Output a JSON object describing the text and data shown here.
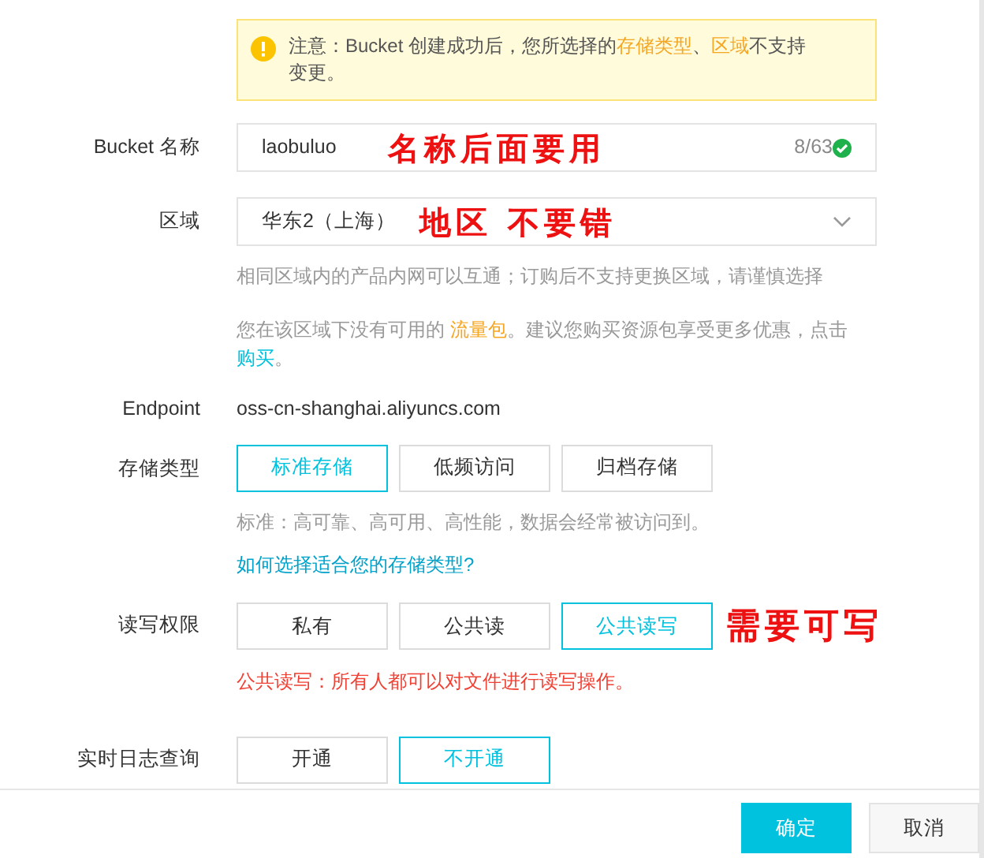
{
  "notice": {
    "segments": [
      {
        "text": "注意：Bucket 创建成功后，您所选择的",
        "kind": "plain"
      },
      {
        "text": "存储类型",
        "kind": "highlight"
      },
      {
        "text": "、",
        "kind": "plain"
      },
      {
        "text": "区域",
        "kind": "highlight"
      },
      {
        "text": "不支持变更。",
        "kind": "plain"
      }
    ]
  },
  "name_field": {
    "label": "Bucket 名称",
    "value": "laobuluo",
    "counter": "8/63",
    "valid": true,
    "annotation": "名称后面要用"
  },
  "region_field": {
    "label": "区域",
    "value": "华东2（上海）",
    "annotation": "地区 不要错",
    "hint": "相同区域内的产品内网可以互通；订购后不支持更换区域，请谨慎选择",
    "promo": [
      {
        "text": "您在该区域下没有可用的 ",
        "kind": "plain"
      },
      {
        "text": "流量包",
        "kind": "highlight"
      },
      {
        "text": "。建议您购买资源包享受更多优惠，点击 ",
        "kind": "plain"
      },
      {
        "text": "购买",
        "kind": "link"
      },
      {
        "text": "。",
        "kind": "plain"
      }
    ]
  },
  "endpoint": {
    "label": "Endpoint",
    "value": "oss-cn-shanghai.aliyuncs.com"
  },
  "storage_class": {
    "label": "存储类型",
    "options": [
      {
        "label": "标准存储",
        "selected": true
      },
      {
        "label": "低频访问",
        "selected": false
      },
      {
        "label": "归档存储",
        "selected": false
      }
    ],
    "hint": "标准：高可靠、高可用、高性能，数据会经常被访问到。",
    "link": "如何选择适合您的存储类型?"
  },
  "acl": {
    "label": "读写权限",
    "options": [
      {
        "label": "私有",
        "selected": false
      },
      {
        "label": "公共读",
        "selected": false
      },
      {
        "label": "公共读写",
        "selected": true
      }
    ],
    "annotation": "需要可写",
    "warning": "公共读写：所有人都可以对文件进行读写操作。"
  },
  "log_query": {
    "label": "实时日志查询",
    "options": [
      {
        "label": "开通",
        "selected": false
      },
      {
        "label": "不开通",
        "selected": true
      }
    ]
  },
  "buttons": [
    {
      "label": "确定",
      "kind": "primary"
    },
    {
      "label": "取消",
      "kind": "secondary"
    }
  ]
}
